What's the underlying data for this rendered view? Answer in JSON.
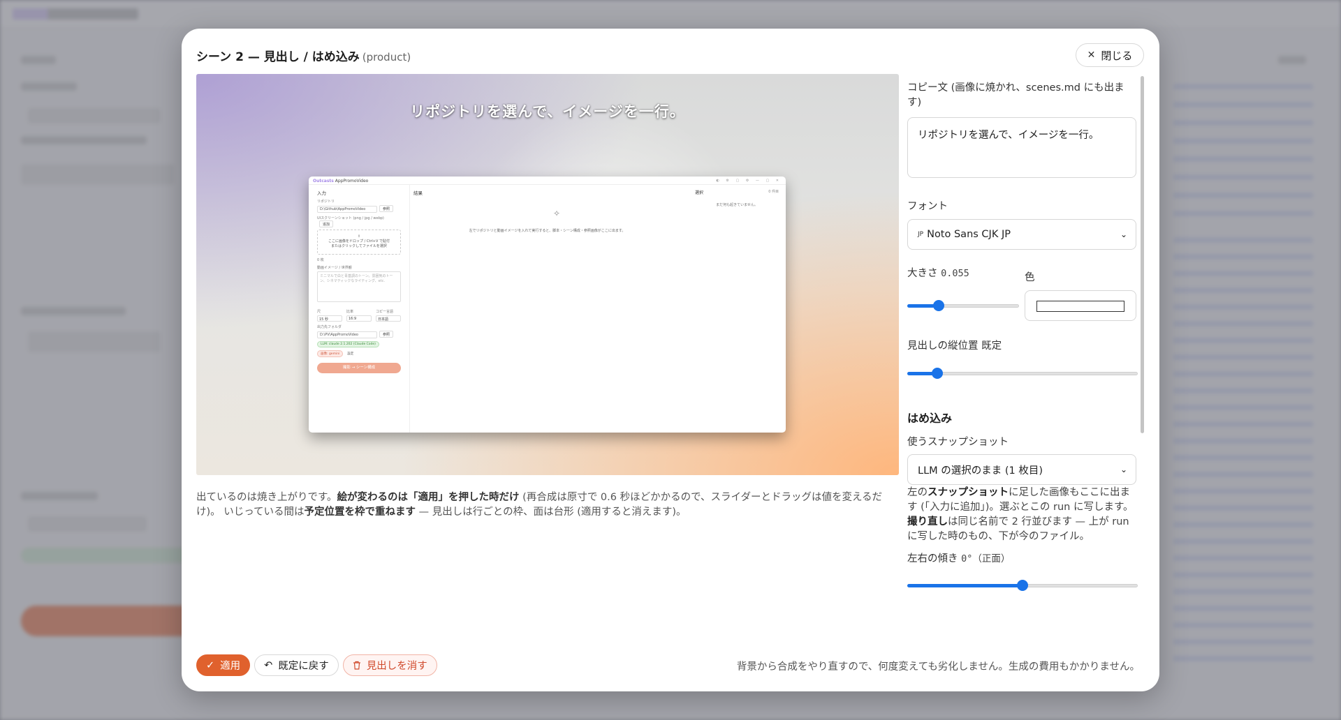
{
  "modal": {
    "title": "シーン 2 — 見出し / はめ込み",
    "title_sub": "(product)",
    "close_label": "閉じる"
  },
  "preview": {
    "headline": "リポジトリを選んで、イメージを一行。",
    "shot": {
      "brand_a": "Outcasts",
      "brand_b": "AppPromoVideo",
      "input_section": "入力",
      "repo_label": "リポジトリ",
      "repo_value": "D:\\Github\\AppPromoVideo",
      "browse": "参照",
      "snap_label": "UIスクリーンショット (png / jpg / webp)",
      "add": "追加",
      "drop_line1": "ここに画像をドロップ / Ctrl+V で貼付",
      "drop_line2": "またはクリックしてファイルを選択",
      "count": "0 枚",
      "image_label": "動画イメージ / 世界観",
      "image_placeholder": "ミニマルで白と青基調のトーン。雰囲気のトーン、シネマティックなライティング、etc.",
      "len_label": "尺",
      "len_value": "15 秒",
      "ratio_label": "比率",
      "ratio_value": "16:9",
      "lang_label": "コピー言語",
      "lang_value": "日本語",
      "out_label": "出力先フォルダ",
      "out_value": "D:\\PV\\AppPromoVideo",
      "llm_pill": "LLM: claude 2.1.202 (Claude Code)",
      "img_pill": "画像: gemini",
      "settings_pill": "設定",
      "run_button": "撮影 → シーン構成",
      "result_head": "結果",
      "result_msg": "左でリポジトリと動画イメージを入れて実行すると、脚本・シーン構成・参照画像がここに出ます。",
      "select_head": "選択",
      "select_count": "0 件目",
      "select_empty": "まだ何も起きていません。"
    }
  },
  "caption": {
    "part1": "出ているのは焼き上がりです。",
    "part2": "絵が変わるのは「適用」を押した時だけ",
    "part3": " (再合成は原寸で 0.6 秒ほどかかるので、スライダーとドラッグは値を変えるだけ)。 いじっている間は",
    "part4": "予定位置を枠で重ねます",
    "part5": " — 見出しは行ごとの枠、面は台形 (適用すると消えます)。"
  },
  "settings": {
    "copy_label": "コピー文 (画像に焼かれ、scenes.md にも出ます)",
    "copy_value": "リポジトリを選んで、イメージを一行。",
    "font_label": "フォント",
    "font_badge": "JP",
    "font_value": "Noto Sans CJK JP",
    "size_label": "大きさ",
    "size_value": "0.055",
    "size_fraction": 0.28,
    "color_label": "色",
    "color_value": "#ffffff",
    "vpos_label": "見出しの縦位置",
    "vpos_value": "既定",
    "vpos_fraction": 0.13,
    "fit_heading": "はめ込み",
    "snapshot_label": "使うスナップショット",
    "snapshot_value": "LLM の選択のまま (1 枚目)",
    "note_p1": "左の",
    "note_b1": "スナップショット",
    "note_p2": "に足した画像もここに出ます (「入力に追加」)。選ぶとこの run に写します。",
    "note_b2": "撮り直し",
    "note_p3": "は同じ名前で 2 行並びます — 上が run に写した時のもの、下が今のファイル。",
    "tilt_label": "左右の傾き",
    "tilt_value": "0°（正面）",
    "tilt_fraction": 0.5
  },
  "footer": {
    "apply": "適用",
    "reset": "既定に戻す",
    "remove": "見出しを消す",
    "note": "背景から合成をやり直すので、何度変えても劣化しません。生成の費用もかかりません。"
  },
  "colors": {
    "accent": "#e0612d",
    "slider": "#1a73e8",
    "danger": "#d04a2c"
  },
  "icons": {
    "close": "x-icon",
    "apply": "check-icon",
    "reset": "undo-icon",
    "remove": "trash-icon"
  }
}
